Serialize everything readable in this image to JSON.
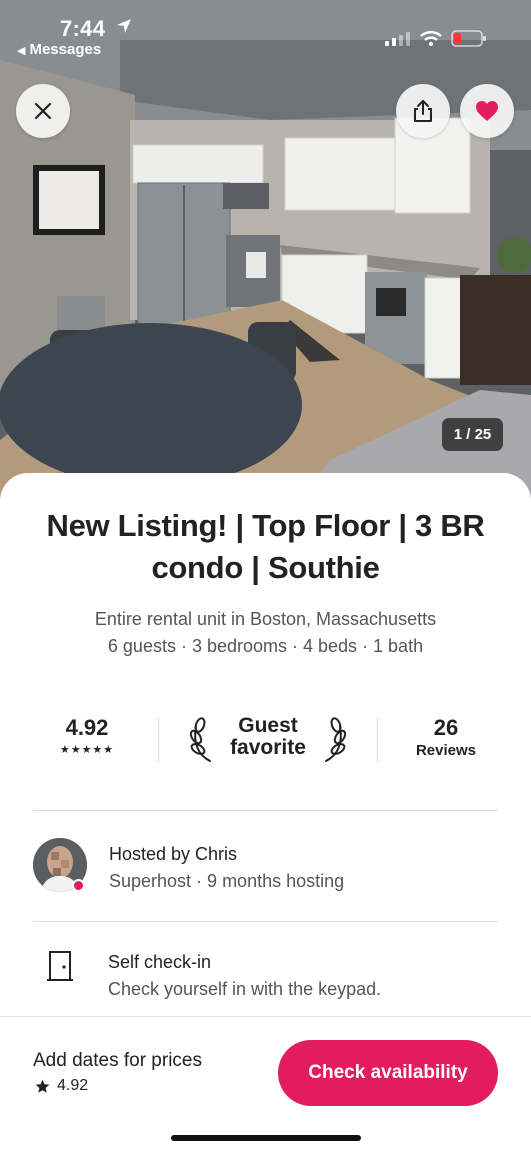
{
  "status_bar": {
    "time": "7:44",
    "back_app": "Messages"
  },
  "photo": {
    "counter": "1 / 25"
  },
  "listing": {
    "title_line1": "New Listing! | Top Floor | 3 BR",
    "title_line2": "condo | Southie",
    "subtitle": "Entire rental unit in Boston, Massachusetts",
    "facts": "6 guests · 3 bedrooms · 4 beds · 1 bath"
  },
  "stats": {
    "rating": "4.92",
    "stars": "★★★★★",
    "favorite_line1": "Guest",
    "favorite_line2": "favorite",
    "reviews_count": "26",
    "reviews_label": "Reviews"
  },
  "host": {
    "name": "Hosted by Chris",
    "meta": "Superhost · 9 months hosting"
  },
  "highlight": {
    "title": "Self check-in",
    "description": "Check yourself in with the keypad."
  },
  "footer": {
    "price_cta": "Add dates for prices",
    "rating": "4.92",
    "button_label": "Check availability"
  },
  "colors": {
    "brand": "#e31c5f",
    "text": "#222222",
    "muted": "#555555",
    "divider": "#dddddd"
  },
  "icons": [
    "navigation-arrow-icon",
    "signal-icon",
    "wifi-icon",
    "battery-icon",
    "close-icon",
    "share-icon",
    "heart-icon",
    "laurel-icon",
    "door-icon",
    "star-icon"
  ]
}
